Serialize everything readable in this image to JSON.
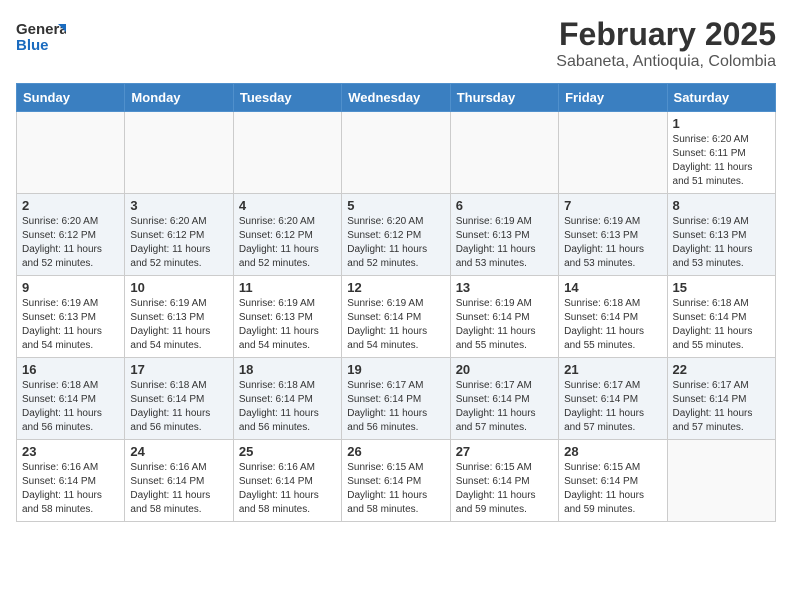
{
  "header": {
    "logo_general": "General",
    "logo_blue": "Blue",
    "title": "February 2025",
    "subtitle": "Sabaneta, Antioquia, Colombia"
  },
  "weekdays": [
    "Sunday",
    "Monday",
    "Tuesday",
    "Wednesday",
    "Thursday",
    "Friday",
    "Saturday"
  ],
  "weeks": [
    {
      "shaded": false,
      "days": [
        {
          "num": "",
          "info": ""
        },
        {
          "num": "",
          "info": ""
        },
        {
          "num": "",
          "info": ""
        },
        {
          "num": "",
          "info": ""
        },
        {
          "num": "",
          "info": ""
        },
        {
          "num": "",
          "info": ""
        },
        {
          "num": "1",
          "info": "Sunrise: 6:20 AM\nSunset: 6:11 PM\nDaylight: 11 hours and 51 minutes."
        }
      ]
    },
    {
      "shaded": true,
      "days": [
        {
          "num": "2",
          "info": "Sunrise: 6:20 AM\nSunset: 6:12 PM\nDaylight: 11 hours and 52 minutes."
        },
        {
          "num": "3",
          "info": "Sunrise: 6:20 AM\nSunset: 6:12 PM\nDaylight: 11 hours and 52 minutes."
        },
        {
          "num": "4",
          "info": "Sunrise: 6:20 AM\nSunset: 6:12 PM\nDaylight: 11 hours and 52 minutes."
        },
        {
          "num": "5",
          "info": "Sunrise: 6:20 AM\nSunset: 6:12 PM\nDaylight: 11 hours and 52 minutes."
        },
        {
          "num": "6",
          "info": "Sunrise: 6:19 AM\nSunset: 6:13 PM\nDaylight: 11 hours and 53 minutes."
        },
        {
          "num": "7",
          "info": "Sunrise: 6:19 AM\nSunset: 6:13 PM\nDaylight: 11 hours and 53 minutes."
        },
        {
          "num": "8",
          "info": "Sunrise: 6:19 AM\nSunset: 6:13 PM\nDaylight: 11 hours and 53 minutes."
        }
      ]
    },
    {
      "shaded": false,
      "days": [
        {
          "num": "9",
          "info": "Sunrise: 6:19 AM\nSunset: 6:13 PM\nDaylight: 11 hours and 54 minutes."
        },
        {
          "num": "10",
          "info": "Sunrise: 6:19 AM\nSunset: 6:13 PM\nDaylight: 11 hours and 54 minutes."
        },
        {
          "num": "11",
          "info": "Sunrise: 6:19 AM\nSunset: 6:13 PM\nDaylight: 11 hours and 54 minutes."
        },
        {
          "num": "12",
          "info": "Sunrise: 6:19 AM\nSunset: 6:14 PM\nDaylight: 11 hours and 54 minutes."
        },
        {
          "num": "13",
          "info": "Sunrise: 6:19 AM\nSunset: 6:14 PM\nDaylight: 11 hours and 55 minutes."
        },
        {
          "num": "14",
          "info": "Sunrise: 6:18 AM\nSunset: 6:14 PM\nDaylight: 11 hours and 55 minutes."
        },
        {
          "num": "15",
          "info": "Sunrise: 6:18 AM\nSunset: 6:14 PM\nDaylight: 11 hours and 55 minutes."
        }
      ]
    },
    {
      "shaded": true,
      "days": [
        {
          "num": "16",
          "info": "Sunrise: 6:18 AM\nSunset: 6:14 PM\nDaylight: 11 hours and 56 minutes."
        },
        {
          "num": "17",
          "info": "Sunrise: 6:18 AM\nSunset: 6:14 PM\nDaylight: 11 hours and 56 minutes."
        },
        {
          "num": "18",
          "info": "Sunrise: 6:18 AM\nSunset: 6:14 PM\nDaylight: 11 hours and 56 minutes."
        },
        {
          "num": "19",
          "info": "Sunrise: 6:17 AM\nSunset: 6:14 PM\nDaylight: 11 hours and 56 minutes."
        },
        {
          "num": "20",
          "info": "Sunrise: 6:17 AM\nSunset: 6:14 PM\nDaylight: 11 hours and 57 minutes."
        },
        {
          "num": "21",
          "info": "Sunrise: 6:17 AM\nSunset: 6:14 PM\nDaylight: 11 hours and 57 minutes."
        },
        {
          "num": "22",
          "info": "Sunrise: 6:17 AM\nSunset: 6:14 PM\nDaylight: 11 hours and 57 minutes."
        }
      ]
    },
    {
      "shaded": false,
      "days": [
        {
          "num": "23",
          "info": "Sunrise: 6:16 AM\nSunset: 6:14 PM\nDaylight: 11 hours and 58 minutes."
        },
        {
          "num": "24",
          "info": "Sunrise: 6:16 AM\nSunset: 6:14 PM\nDaylight: 11 hours and 58 minutes."
        },
        {
          "num": "25",
          "info": "Sunrise: 6:16 AM\nSunset: 6:14 PM\nDaylight: 11 hours and 58 minutes."
        },
        {
          "num": "26",
          "info": "Sunrise: 6:15 AM\nSunset: 6:14 PM\nDaylight: 11 hours and 58 minutes."
        },
        {
          "num": "27",
          "info": "Sunrise: 6:15 AM\nSunset: 6:14 PM\nDaylight: 11 hours and 59 minutes."
        },
        {
          "num": "28",
          "info": "Sunrise: 6:15 AM\nSunset: 6:14 PM\nDaylight: 11 hours and 59 minutes."
        },
        {
          "num": "",
          "info": ""
        }
      ]
    }
  ]
}
